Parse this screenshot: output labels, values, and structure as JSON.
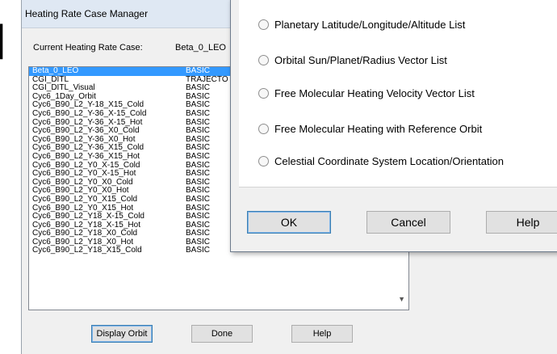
{
  "window": {
    "title": "Heating Rate Case Manager",
    "current_label": "Current Heating Rate Case:",
    "current_value": "Beta_0_LEO"
  },
  "cases": [
    {
      "name": "Beta_0_LEO",
      "type": "BASIC"
    },
    {
      "name": "CGI_DITL",
      "type": "TRAJECTO"
    },
    {
      "name": "CGI_DITL_Visual",
      "type": "BASIC"
    },
    {
      "name": "Cyc6_1Day_Orbit",
      "type": "BASIC"
    },
    {
      "name": "Cyc6_B90_L2_Y-18_X15_Cold",
      "type": "BASIC"
    },
    {
      "name": "Cyc6_B90_L2_Y-36_X-15_Cold",
      "type": "BASIC"
    },
    {
      "name": "Cyc6_B90_L2_Y-36_X-15_Hot",
      "type": "BASIC"
    },
    {
      "name": "Cyc6_B90_L2_Y-36_X0_Cold",
      "type": "BASIC"
    },
    {
      "name": "Cyc6_B90_L2_Y-36_X0_Hot",
      "type": "BASIC"
    },
    {
      "name": "Cyc6_B90_L2_Y-36_X15_Cold",
      "type": "BASIC"
    },
    {
      "name": "Cyc6_B90_L2_Y-36_X15_Hot",
      "type": "BASIC"
    },
    {
      "name": "Cyc6_B90_L2_Y0_X-15_Cold",
      "type": "BASIC"
    },
    {
      "name": "Cyc6_B90_L2_Y0_X-15_Hot",
      "type": "BASIC"
    },
    {
      "name": "Cyc6_B90_L2_Y0_X0_Cold",
      "type": "BASIC"
    },
    {
      "name": "Cyc6_B90_L2_Y0_X0_Hot",
      "type": "BASIC"
    },
    {
      "name": "Cyc6_B90_L2_Y0_X15_Cold",
      "type": "BASIC"
    },
    {
      "name": "Cyc6_B90_L2_Y0_X15_Hot",
      "type": "BASIC"
    },
    {
      "name": "Cyc6_B90_L2_Y18_X-15_Cold",
      "type": "BASIC"
    },
    {
      "name": "Cyc6_B90_L2_Y18_X-15_Hot",
      "type": "BASIC"
    },
    {
      "name": "Cyc6_B90_L2_Y18_X0_Cold",
      "type": "BASIC"
    },
    {
      "name": "Cyc6_B90_L2_Y18_X0_Hot",
      "type": "BASIC"
    },
    {
      "name": "Cyc6_B90_L2_Y18_X15_Cold",
      "type": "BASIC"
    }
  ],
  "buttons": {
    "display_orbit": "Display Orbit",
    "done": "Done",
    "help": "Help"
  },
  "dialog": {
    "options": [
      "Planetary Latitude/Longitude/Altitude List",
      "Orbital Sun/Planet/Radius Vector List",
      "Free Molecular Heating Velocity Vector List",
      "Free Molecular Heating with Reference Orbit",
      "Celestial Coordinate System Location/Orientation"
    ],
    "ok": "OK",
    "cancel": "Cancel",
    "help": "Help"
  },
  "icons": {
    "scroll_down": "scroll-down-arrow"
  }
}
